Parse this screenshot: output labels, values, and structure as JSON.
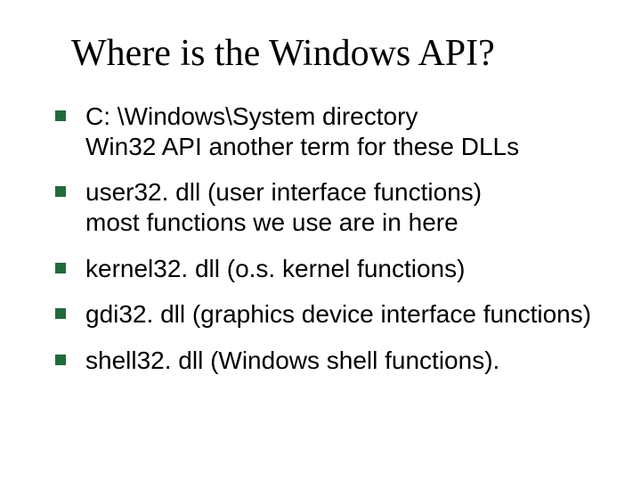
{
  "slide": {
    "title": "Where is the Windows API?",
    "bullets": [
      {
        "lines": [
          "C: \\Windows\\System directory",
          "Win32 API another term for these DLLs"
        ]
      },
      {
        "lines": [
          "user32. dll (user interface functions)",
          "most functions we use are in here"
        ]
      },
      {
        "lines": [
          "kernel32. dll (o.s. kernel functions)"
        ]
      },
      {
        "lines": [
          "gdi32. dll (graphics device interface functions)"
        ]
      },
      {
        "lines": [
          "shell32. dll (Windows shell functions)."
        ]
      }
    ]
  }
}
